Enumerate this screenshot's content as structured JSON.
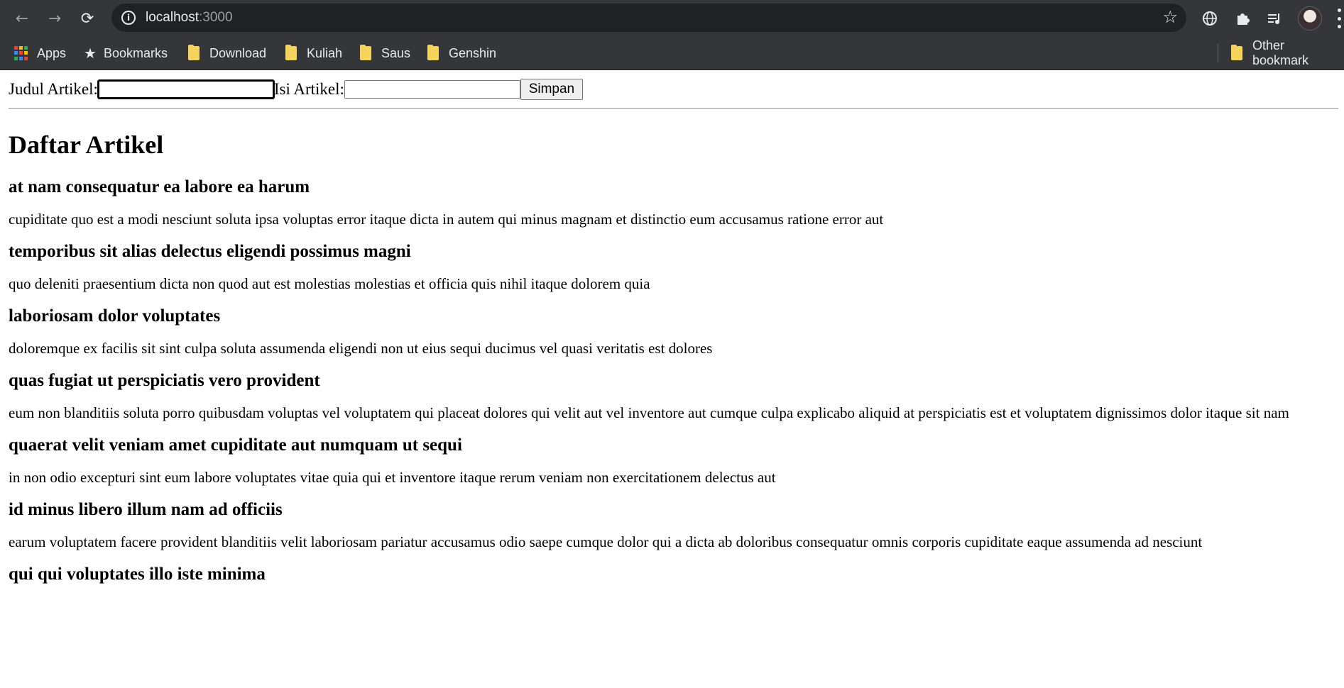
{
  "browser": {
    "url_host": "localhost",
    "url_port": ":3000",
    "bookmarks": [
      {
        "label": "Apps",
        "icon": "apps-grid-icon"
      },
      {
        "label": "Bookmarks",
        "icon": "star-icon"
      },
      {
        "label": "Download",
        "icon": "folder-icon"
      },
      {
        "label": "Kuliah",
        "icon": "folder-icon"
      },
      {
        "label": "Saus",
        "icon": "folder-icon"
      },
      {
        "label": "Genshin",
        "icon": "folder-icon"
      }
    ],
    "other_bookmarks": "Other bookmark"
  },
  "form": {
    "judul_label": "Judul Artikel:",
    "judul_value": "",
    "isi_label": "Isi Artikel:",
    "isi_value": "",
    "submit_label": "Simpan"
  },
  "list_title": "Daftar Artikel",
  "articles": [
    {
      "title": "at nam consequatur ea labore ea harum",
      "body": "cupiditate quo est a modi nesciunt soluta ipsa voluptas error itaque dicta in autem qui minus magnam et distinctio eum accusamus ratione error aut"
    },
    {
      "title": "temporibus sit alias delectus eligendi possimus magni",
      "body": "quo deleniti praesentium dicta non quod aut est molestias molestias et officia quis nihil itaque dolorem quia"
    },
    {
      "title": "laboriosam dolor voluptates",
      "body": "doloremque ex facilis sit sint culpa soluta assumenda eligendi non ut eius sequi ducimus vel quasi veritatis est dolores"
    },
    {
      "title": "quas fugiat ut perspiciatis vero provident",
      "body": "eum non blanditiis soluta porro quibusdam voluptas vel voluptatem qui placeat dolores qui velit aut vel inventore aut cumque culpa explicabo aliquid at perspiciatis est et voluptatem dignissimos dolor itaque sit nam"
    },
    {
      "title": "quaerat velit veniam amet cupiditate aut numquam ut sequi",
      "body": "in non odio excepturi sint eum labore voluptates vitae quia qui et inventore itaque rerum veniam non exercitationem delectus aut"
    },
    {
      "title": "id minus libero illum nam ad officiis",
      "body": "earum voluptatem facere provident blanditiis velit laboriosam pariatur accusamus odio saepe cumque dolor qui a dicta ab doloribus consequatur omnis corporis cupiditate eaque assumenda ad nesciunt"
    },
    {
      "title": "qui qui voluptates illo iste minima",
      "body": ""
    }
  ]
}
